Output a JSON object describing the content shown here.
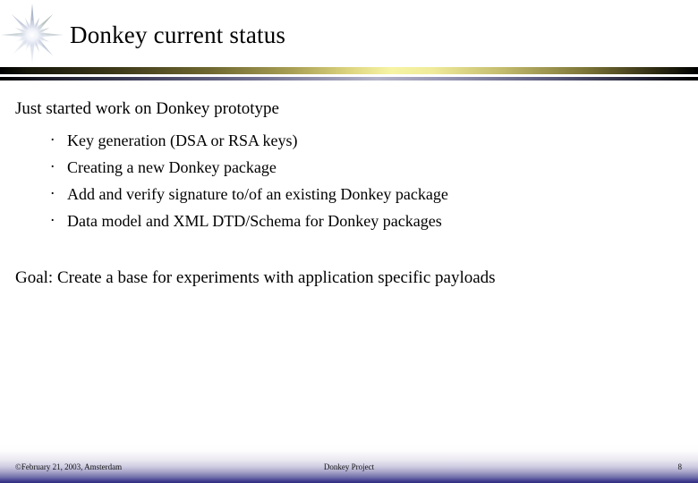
{
  "slide": {
    "title": "Donkey current status",
    "decor": {
      "starburst_icon": "starburst-icon",
      "accent_yellow": "#F6F4A4",
      "accent_lavender": "#B3B3C9",
      "footer_navy": "#2E2B81"
    },
    "body": {
      "lead": "Just started work on Donkey prototype",
      "bullet_glyph": "·",
      "bullets": [
        "Key generation (DSA or RSA keys)",
        "Creating a new Donkey package",
        "Add and verify signature to/of an existing Donkey package",
        "Data model and XML DTD/Schema for Donkey packages"
      ],
      "goal": "Goal: Create a base for experiments with application specific payloads"
    },
    "footer": {
      "left": "©February 21, 2003, Amsterdam",
      "center": "Donkey Project",
      "page_number": "8"
    }
  }
}
